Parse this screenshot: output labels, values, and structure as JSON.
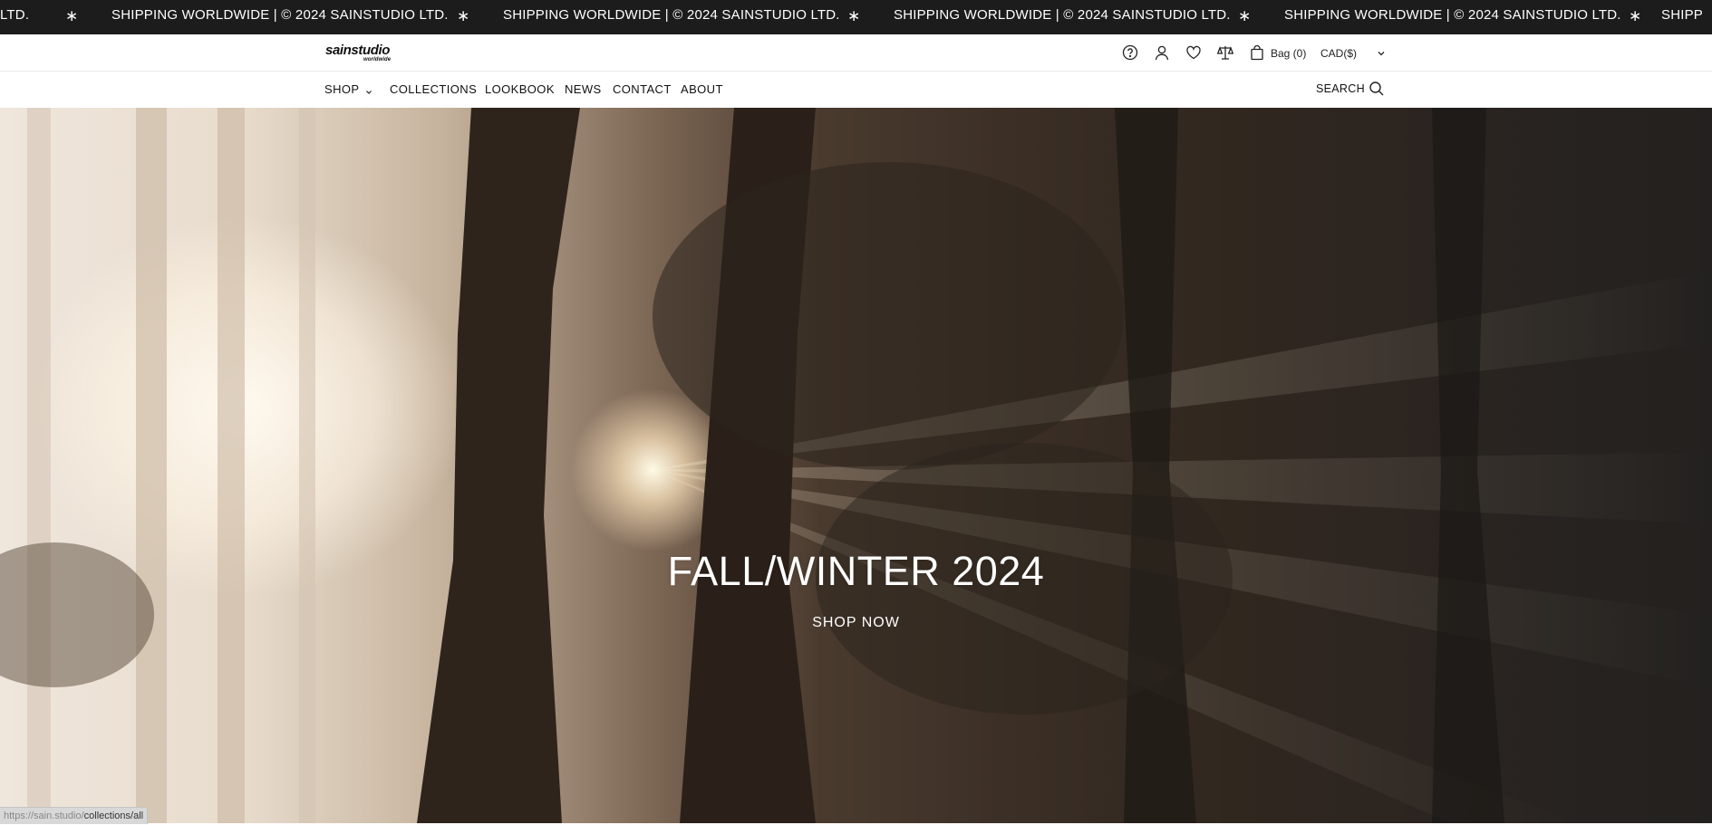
{
  "announcement": {
    "text": "SHIPPING WORLDWIDE | © 2024 SAINSTUDIO LTD.",
    "lead_text": "LTD.",
    "trail_text": "SHIPP",
    "separator": "∗"
  },
  "header": {
    "logo_main": "sainstudio",
    "logo_sub": "worldwide",
    "icons": [
      "help-icon",
      "account-icon",
      "wishlist-icon",
      "compare-icon",
      "bag-icon"
    ],
    "bag_label": "Bag (0)",
    "currency": "CAD($)"
  },
  "nav": {
    "items": [
      "SHOP",
      "COLLECTIONS",
      "LOOKBOOK",
      "NEWS",
      "CONTACT",
      "ABOUT"
    ],
    "search_label": "SEARCH"
  },
  "hero": {
    "title": "FALL/WINTER 2024",
    "cta": "SHOP NOW"
  },
  "status_bar": {
    "url_prefix": "https://sain.studio/",
    "url_path": "collections/all"
  },
  "colors": {
    "ticker_bg": "#1c1c1c",
    "header_bg": "#ffffff",
    "text": "#111111",
    "hero_text": "#ffffff"
  }
}
